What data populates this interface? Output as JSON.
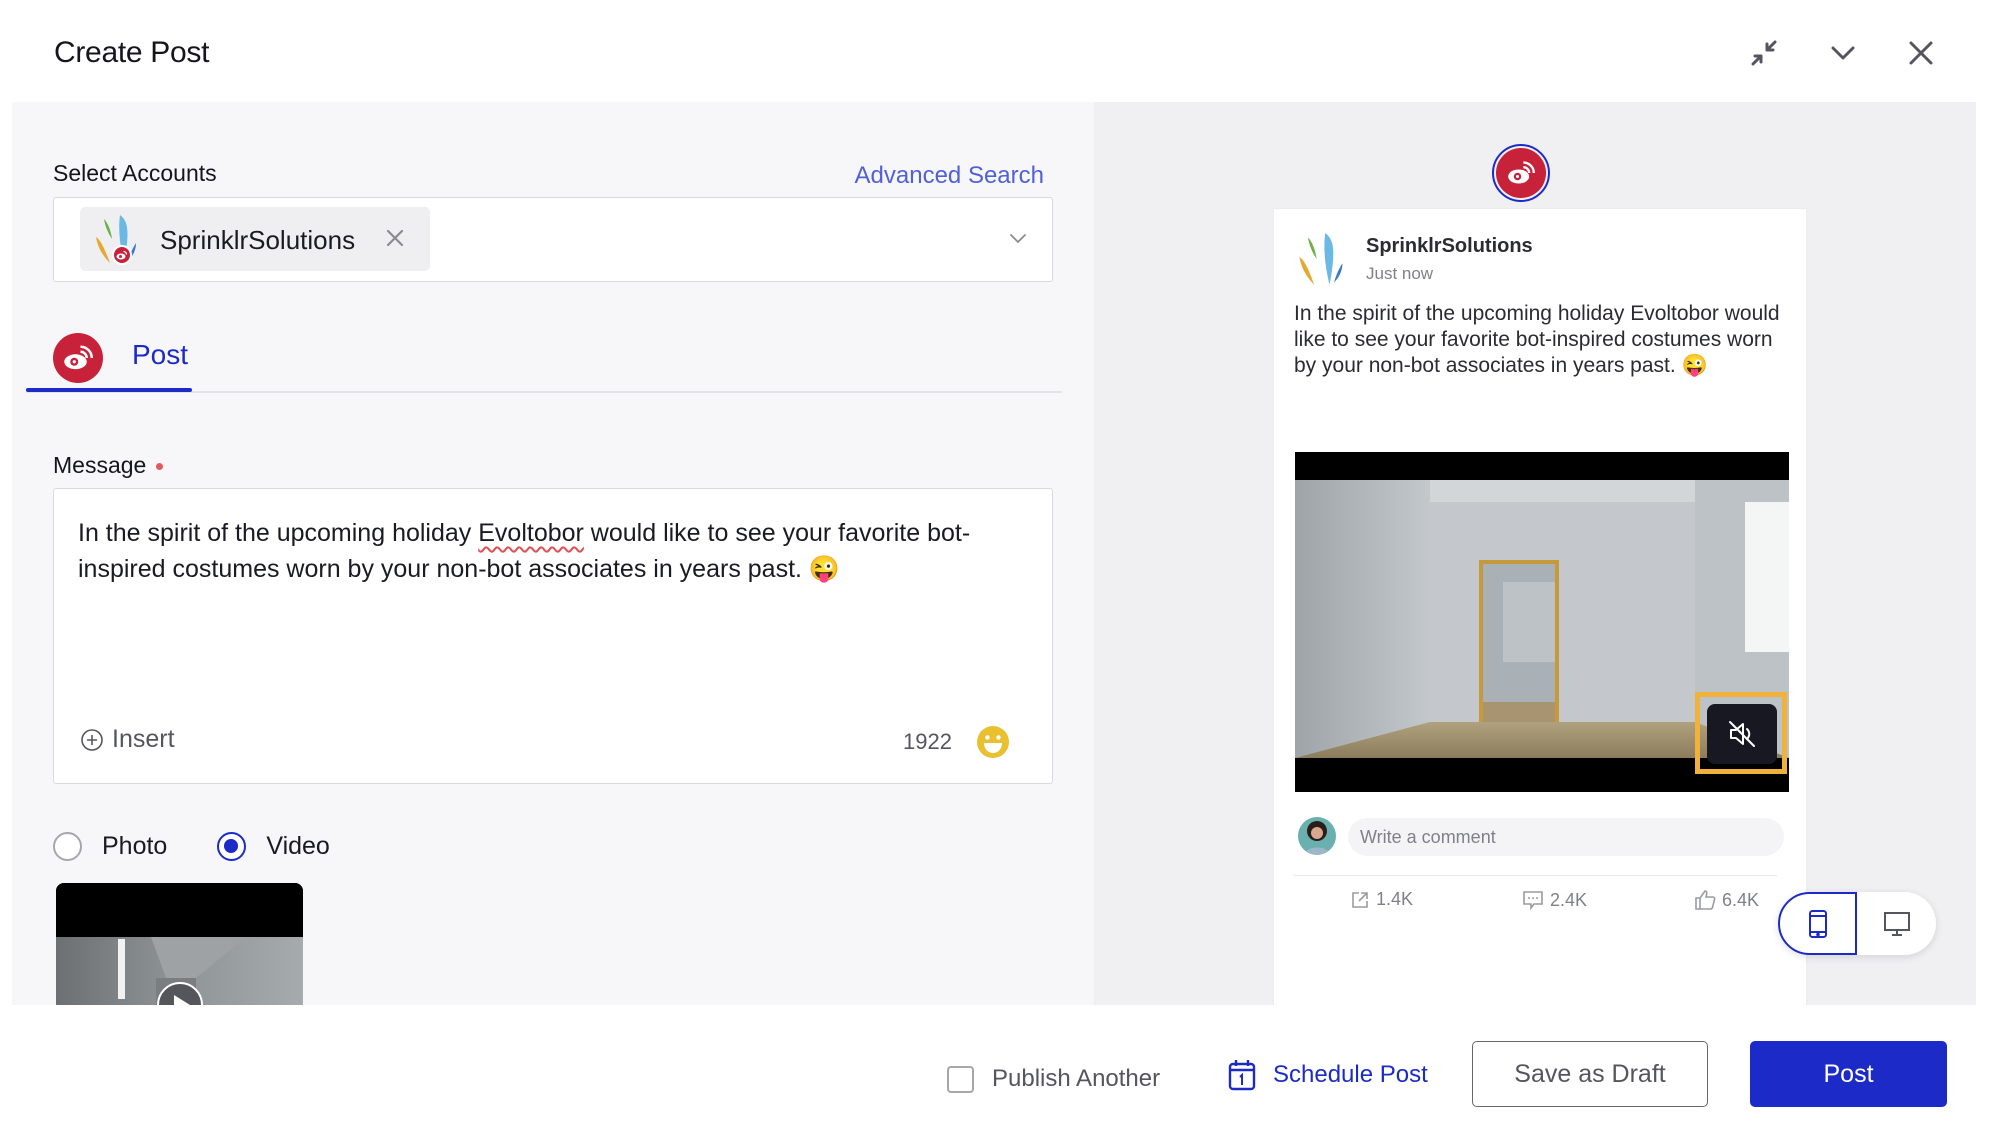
{
  "header": {
    "title": "Create Post",
    "icons": [
      "collapse-icon",
      "chevron-down-icon",
      "close-icon"
    ]
  },
  "accounts": {
    "label": "Select Accounts",
    "advanced_search": "Advanced Search",
    "selected": [
      {
        "name": "SprinklrSolutions",
        "network": "weibo"
      }
    ]
  },
  "tabs": [
    {
      "label": "Post",
      "network": "weibo",
      "active": true
    }
  ],
  "message": {
    "label": "Message",
    "required": true,
    "text_before": "In the spirit of the upcoming holiday ",
    "misspelled": "Evoltobor",
    "text_after": " would like to see your favorite bot-inspired costumes worn by your non-bot associates in years past. 😜",
    "insert_label": "Insert",
    "char_count": "1922"
  },
  "media": {
    "options": [
      {
        "label": "Photo",
        "selected": false
      },
      {
        "label": "Video",
        "selected": true
      }
    ]
  },
  "preview": {
    "account_name": "SprinklrSolutions",
    "time": "Just now",
    "text": "In the spirit of the upcoming holiday Evoltobor would like to see your favorite bot-inspired costumes worn by your non-bot associates in years past. 😜",
    "comment_placeholder": "Write a comment",
    "stats": {
      "shares": "1.4K",
      "comments": "2.4K",
      "likes": "6.4K"
    },
    "device_modes": [
      {
        "name": "mobile",
        "active": true
      },
      {
        "name": "desktop",
        "active": false
      }
    ]
  },
  "footer": {
    "publish_another": "Publish Another",
    "publish_another_checked": false,
    "schedule_post": "Schedule Post",
    "save_draft": "Save as Draft",
    "post": "Post"
  },
  "colors": {
    "accent": "#1c2bc8",
    "weibo_red": "#c8213a",
    "link": "#5060d8",
    "highlight": "#f0b23a"
  }
}
